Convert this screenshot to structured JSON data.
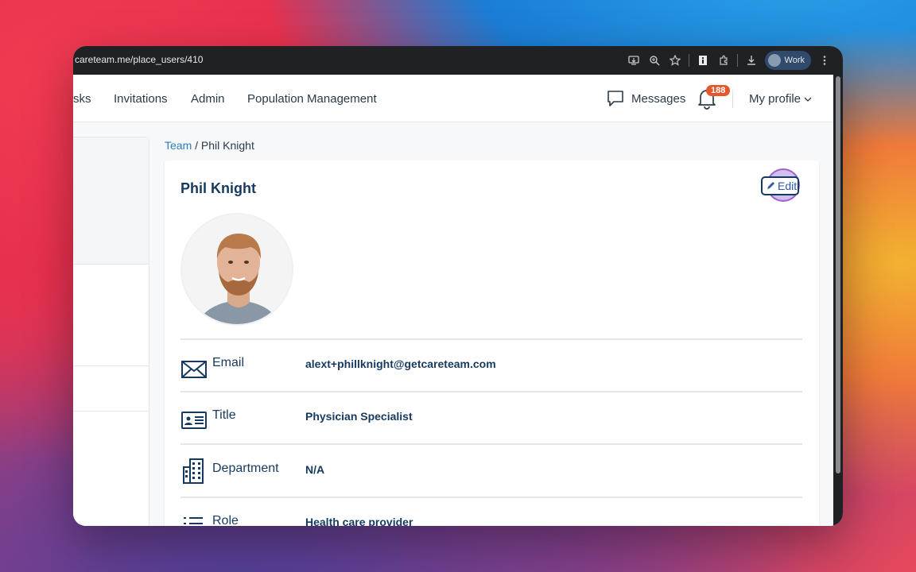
{
  "browser": {
    "url": "careteam.me/place_users/410",
    "profile_label": "Work"
  },
  "nav": {
    "tasks_partial": "sks",
    "invitations": "Invitations",
    "admin": "Admin",
    "population": "Population Management",
    "messages": "Messages",
    "notifications_count": "188",
    "my_profile": "My profile"
  },
  "breadcrumb": {
    "team": "Team",
    "separator": " / ",
    "current": "Phil Knight"
  },
  "profile": {
    "name": "Phil Knight",
    "edit_label": "Edit",
    "fields": [
      {
        "label": "Email",
        "value": "alext+phillknight@getcareteam.com",
        "icon": "envelope-icon"
      },
      {
        "label": "Title",
        "value": "Physician Specialist",
        "icon": "id-card-icon"
      },
      {
        "label": "Department",
        "value": "N/A",
        "icon": "building-icon"
      },
      {
        "label": "Role",
        "value": "Health care provider",
        "icon": "list-icon"
      }
    ]
  },
  "colors": {
    "primary_text": "#163a5f",
    "link": "#2e7bb6",
    "badge": "#e5572b"
  }
}
